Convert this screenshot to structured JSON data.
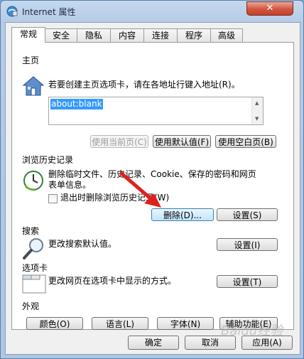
{
  "window": {
    "title": "Internet 属性",
    "close_label": "✕"
  },
  "tabs": [
    "常规",
    "安全",
    "隐私",
    "内容",
    "连接",
    "程序",
    "高级"
  ],
  "home": {
    "title": "主页",
    "desc": "若要创建主页选项卡，请在各地址行键入地址(R)。",
    "url": "about:blank",
    "btn_current": "使用当前页(C)",
    "btn_default": "使用默认值(F)",
    "btn_blank": "使用空白页(B)"
  },
  "history": {
    "title": "浏览历史记录",
    "desc1": "删除临时文件、历史记录、Cookie、保存的密码和网页",
    "desc2": "表单信息。",
    "checkbox_label": "退出时删除浏览历史记录(W)",
    "btn_delete": "删除(D)...",
    "btn_settings": "设置(S)"
  },
  "search": {
    "title": "搜索",
    "desc": "更改搜索默认值。",
    "btn_settings": "设置(I)"
  },
  "tabs_section": {
    "title": "选项卡",
    "desc": "更改网页在选项卡中显示的方式。",
    "btn_settings": "设置(T)"
  },
  "appearance": {
    "title": "外观",
    "btn_colors": "颜色(O)",
    "btn_languages": "语言(L)",
    "btn_fonts": "字体(N)",
    "btn_accessibility": "辅助功能(E)"
  },
  "footer": {
    "ok": "确定",
    "cancel": "取消",
    "apply": "应用(A)"
  },
  "watermark": "Baidu经验"
}
